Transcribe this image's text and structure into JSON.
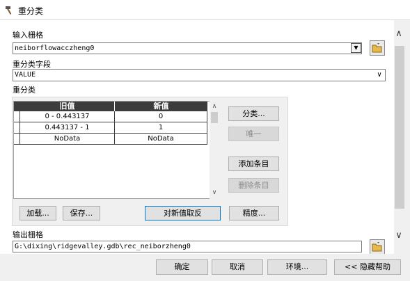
{
  "window": {
    "title": "重分类",
    "icon": "hammer-icon"
  },
  "input_raster": {
    "label": "输入栅格",
    "value": "neiborflowacczheng0",
    "dropdown_icon": "▼",
    "browse_icon": "folder-open-icon"
  },
  "reclass_field": {
    "label": "重分类字段",
    "value": "VALUE",
    "dropdown_icon": "∨"
  },
  "reclassification": {
    "label": "重分类",
    "columns": [
      "旧值",
      "新值"
    ],
    "rows": [
      {
        "old": "0 - 0.443137",
        "new": "0"
      },
      {
        "old": "0.443137 - 1",
        "new": "1"
      },
      {
        "old": "NoData",
        "new": "NoData"
      }
    ],
    "side_buttons": {
      "classify": "分类...",
      "unique": "唯一",
      "add_entry": "添加条目",
      "delete_entry": "删除条目"
    },
    "bottom_buttons": {
      "load": "加载...",
      "save": "保存...",
      "reverse": "对新值取反",
      "precision": "精度..."
    },
    "scroll_up": "∧",
    "scroll_down": "∨"
  },
  "output_raster": {
    "label": "输出栅格",
    "value": "G:\\dixing\\ridgevalley.gdb\\rec_neiborzheng0",
    "browse_icon": "folder-open-icon"
  },
  "panel_scroll": {
    "up": "∧",
    "down": "∨"
  },
  "footer": {
    "ok": "确定",
    "cancel": "取消",
    "environments": "环境...",
    "hide_help": "<< 隐藏帮助"
  },
  "colors": {
    "table_header": "#3c3c3c",
    "focus_border": "#0078d7",
    "folder": "#e8b84a"
  }
}
